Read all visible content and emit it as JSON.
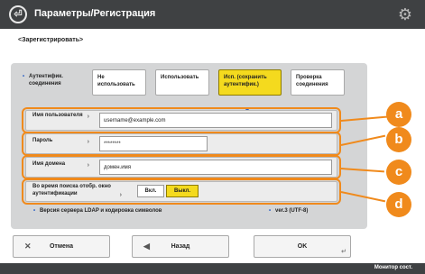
{
  "header": {
    "title": "Параметры/Регистрация",
    "back_icon": "home-arrow-icon",
    "settings_icon": "gear-icon"
  },
  "sub_label": "<Зарегистрировать>",
  "tabs": [
    {
      "label": "Аутентифик. соединения",
      "state": "default"
    },
    {
      "label": "Не использовать",
      "state": "default"
    },
    {
      "label": "Использовать",
      "state": "default"
    },
    {
      "label": "Исп. (сохранить аутентифик.)",
      "state": "selected"
    },
    {
      "label": "Проверка соединения",
      "state": "default"
    }
  ],
  "fields": {
    "username_label": "Имя пользователя",
    "username_value": "username@example.com",
    "password_label": "Пароль",
    "password_value": "********",
    "domain_label": "Имя домена",
    "domain_value": "домен.имя"
  },
  "toggle": {
    "label": "Во время поиска отобр. окно аутентификации",
    "off_label": "Вкл.",
    "on_label": "Выкл.",
    "selected": "Выкл."
  },
  "note": {
    "left": "Версия сервера LDAP и кодировка символов",
    "right": "ver.3 (UTF-8)"
  },
  "callouts": [
    "a",
    "b",
    "c",
    "d"
  ],
  "buttons": {
    "cancel": "Отмена",
    "back": "Назад",
    "ok": "OK"
  },
  "footer": {
    "text": "Монитор сост."
  },
  "colors": {
    "accent": "#f08a1c",
    "selected": "#f4da1e",
    "header": "#3f4143",
    "panel": "#d4d5d6"
  }
}
